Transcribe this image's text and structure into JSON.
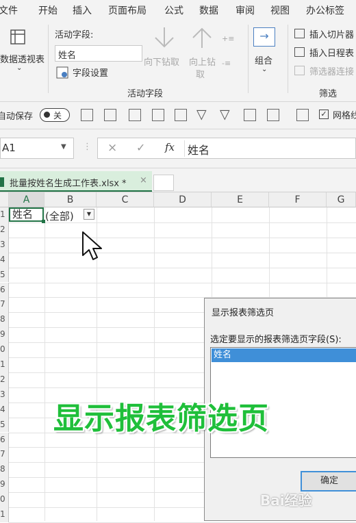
{
  "menu": [
    "文件",
    "开始",
    "插入",
    "页面布局",
    "公式",
    "数据",
    "审阅",
    "视图",
    "办公标签"
  ],
  "ribbon": {
    "pivot_label": "数据透视表",
    "active_field_label": "活动字段:",
    "active_field_value": "姓名",
    "field_settings": "字段设置",
    "drill_down": "向下钻取",
    "drill_up_line1": "向上钻",
    "drill_up_line2": "取",
    "group_active_field": "活动字段",
    "combine": "组合",
    "insert_slicer": "插入切片器",
    "insert_timeline": "插入日程表",
    "filter_connections": "筛选器连接",
    "group_filter": "筛选"
  },
  "quick_access": {
    "autosave": "自动保存",
    "toggle_state": "关",
    "gridlines": "网格线"
  },
  "formula_bar": {
    "name_box": "A1",
    "formula": "姓名"
  },
  "file_tab": {
    "name": "批量按姓名生成工作表.xlsx *",
    "close": "×"
  },
  "sheet": {
    "columns": [
      "A",
      "B",
      "C",
      "D",
      "E",
      "F",
      "G"
    ],
    "rows": [
      "1",
      "2",
      "3",
      "4",
      "5",
      "6",
      "7",
      "8",
      "9",
      "0",
      "1",
      "2",
      "3",
      "4",
      "5",
      "6",
      "7",
      "8",
      "9",
      "0",
      "1"
    ],
    "a1": "姓名",
    "b1": "(全部)"
  },
  "dialog": {
    "title": "显示报表筛选页",
    "prompt": "选定要显示的报表筛选页字段(S):",
    "items": [
      "姓名"
    ],
    "ok": "确定"
  },
  "caption": "显示报表筛选页",
  "watermark": "Bai经验"
}
